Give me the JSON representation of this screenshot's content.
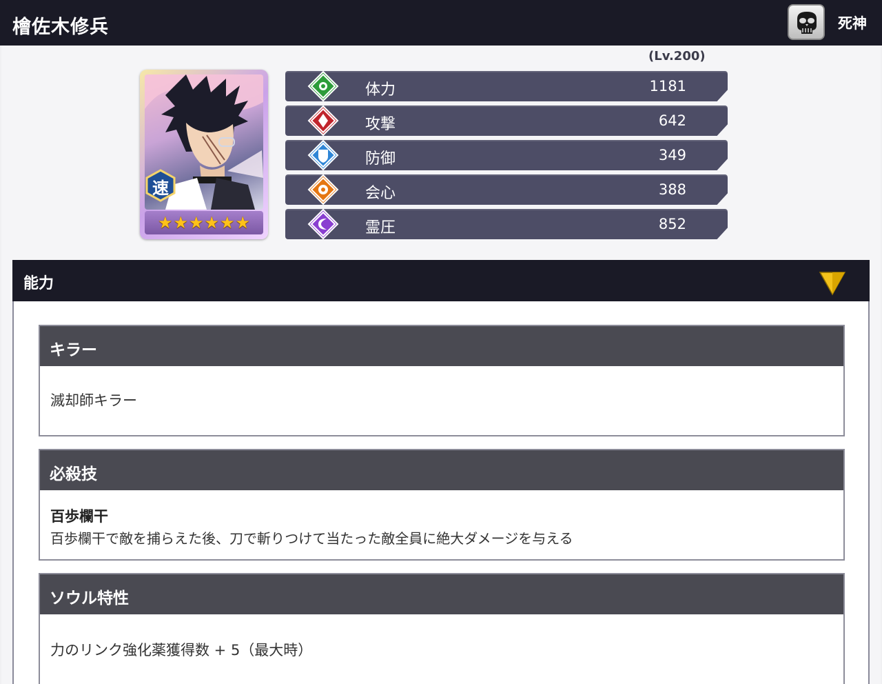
{
  "header": {
    "character_name": "檜佐木修兵",
    "faction_label": "死神",
    "faction_icon": "skull-mask-icon"
  },
  "card": {
    "speed_badge": "速",
    "stars": 6
  },
  "level_text": "(Lv.200)",
  "stats": [
    {
      "icon": "hp-emblem-icon",
      "color": "#2d9c3a",
      "label": "体力",
      "value": "1181"
    },
    {
      "icon": "attack-emblem-icon",
      "color": "#c0242c",
      "label": "攻撃",
      "value": "642"
    },
    {
      "icon": "defense-emblem-icon",
      "color": "#2f86d6",
      "label": "防御",
      "value": "349"
    },
    {
      "icon": "critical-emblem-icon",
      "color": "#e57712",
      "label": "会心",
      "value": "388"
    },
    {
      "icon": "spirit-emblem-icon",
      "color": "#8a3fd1",
      "label": "霊圧",
      "value": "852"
    }
  ],
  "ability_panel": {
    "title": "能力",
    "toggle_icon": "chevron-down-icon"
  },
  "sections": [
    {
      "header": "キラー",
      "body": "滅却師キラー"
    },
    {
      "header": "必殺技",
      "skill_name": "百歩欄干",
      "body": "百歩欄干で敵を捕らえた後、刀で斬りつけて当たった敵全員に絶大ダメージを与える"
    },
    {
      "header": "ソウル特性",
      "body": "力のリンク強化薬獲得数 + 5（最大時）"
    }
  ]
}
